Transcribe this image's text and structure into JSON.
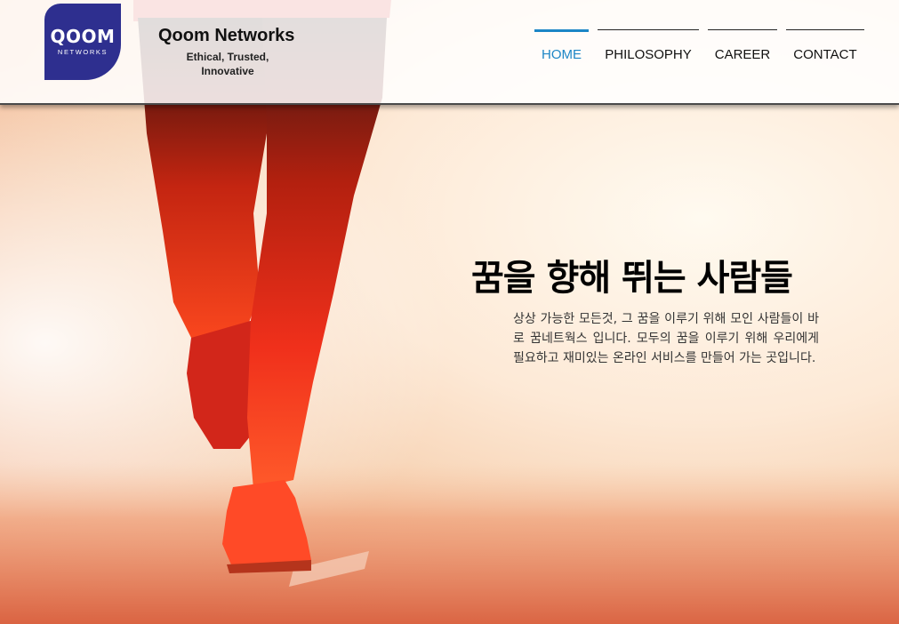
{
  "header": {
    "logo": {
      "word": "QOOM",
      "sub": "NETWORKS",
      "color": "#2e2f8f"
    },
    "brand_name": "Qoom Networks",
    "tagline": "Ethical, Trusted, Innovative"
  },
  "nav": {
    "items": [
      {
        "label": "HOME",
        "active": true
      },
      {
        "label": "PHILOSOPHY",
        "active": false
      },
      {
        "label": "CAREER",
        "active": false
      },
      {
        "label": "CONTACT",
        "active": false
      }
    ],
    "active_color": "#1c86c6"
  },
  "hero": {
    "headline": "꿈을 향해 뛰는 사람들",
    "body": "상상 가능한 모든것, 그 꿈을 이루기 위해 모인 사람들이 바로 꿈네트웍스 입니다.  모두의 꿈을 이루기 위해 우리에게 필요하고 재미있는 온라인 서비스를 만들어 가는 곳입니다.",
    "image": "runner-legs-sunrise-photo"
  }
}
